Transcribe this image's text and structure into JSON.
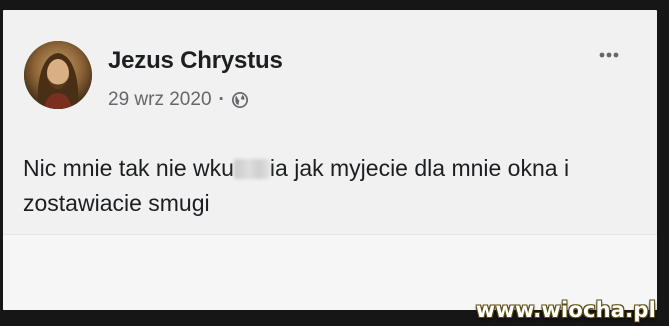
{
  "post": {
    "author": "Jezus Chrystus",
    "date": "29 wrz 2020",
    "separator": "·",
    "privacy_icon": "globe-icon",
    "more_icon": "more-options-icon",
    "text_part1": "Nic mnie tak nie wku",
    "text_censored": "censored-blur",
    "text_part2": "ia jak myjecie dla mnie okna i zostawiacie smugi"
  },
  "watermark": {
    "text": "www.wiocha.pl"
  },
  "colors": {
    "card_background": "#f1f1f1",
    "author_text": "#1c1e21",
    "meta_text": "#65676b",
    "frame": "#161616"
  }
}
